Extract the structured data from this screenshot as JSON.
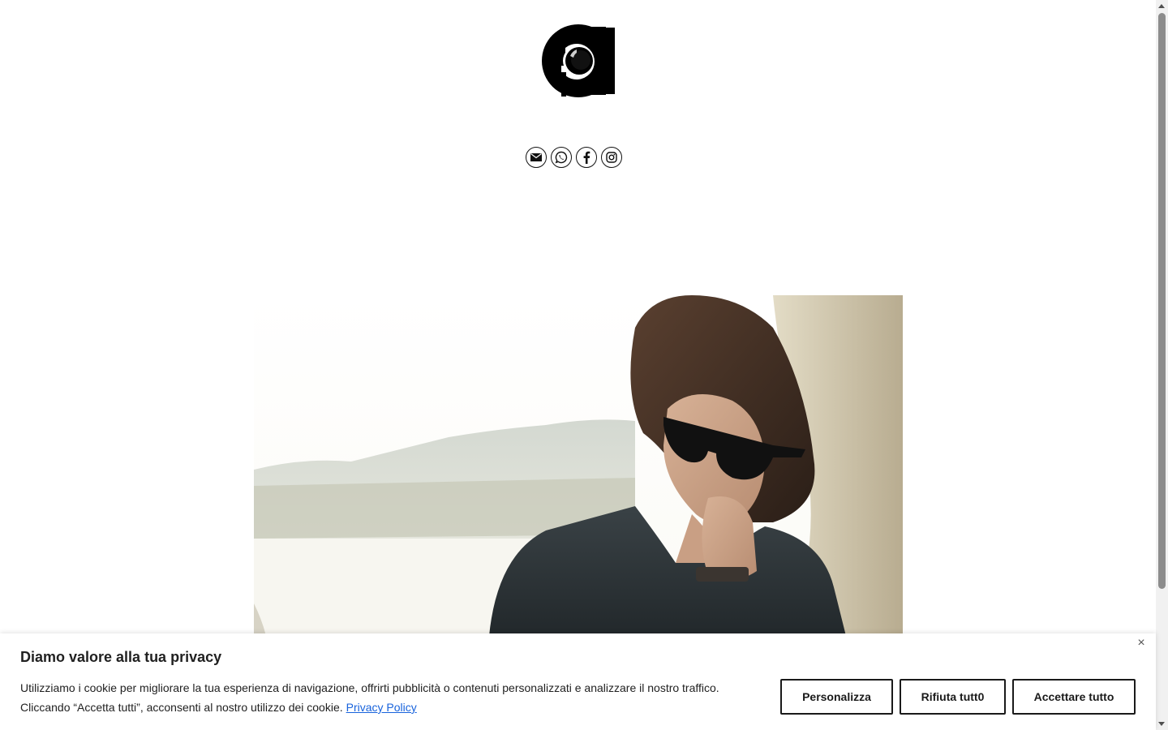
{
  "header": {
    "logo_icon": "camera-aperture-logo-icon"
  },
  "social": [
    {
      "name": "email",
      "icon": "envelope-icon"
    },
    {
      "name": "whatsapp",
      "icon": "whatsapp-icon"
    },
    {
      "name": "facebook",
      "icon": "facebook-icon"
    },
    {
      "name": "instagram",
      "icon": "instagram-icon"
    }
  ],
  "hero": {
    "image": "woman-in-sunglasses-photo"
  },
  "cookie": {
    "title": "Diamo valore alla tua privacy",
    "text": "Utilizziamo i cookie per migliorare la tua esperienza di navigazione, offrirti pubblicità o contenuti personalizzati e analizzare il nostro traffico. Cliccando “Accetta tutti”, acconsenti al nostro utilizzo dei cookie.",
    "privacy_link": "Privacy Policy",
    "close_icon": "×",
    "buttons": {
      "customize": "Personalizza",
      "reject": "Rifiuta tutt0",
      "accept": "Accettare tutto"
    },
    "link_color": "#1863dc"
  }
}
